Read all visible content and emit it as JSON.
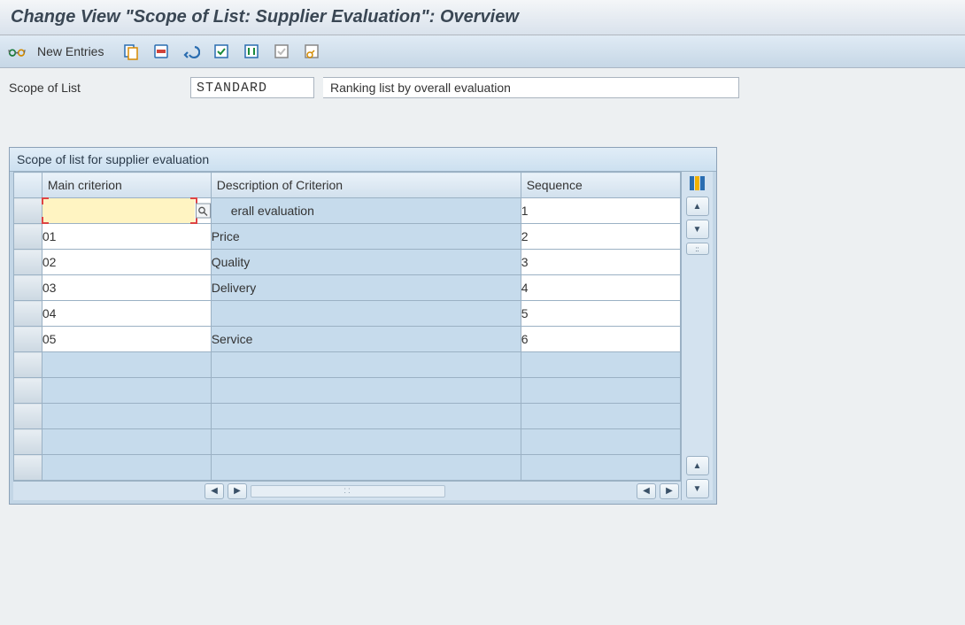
{
  "title": "Change View \"Scope of List: Supplier Evaluation\": Overview",
  "toolbar": {
    "new_entries_label": "New Entries"
  },
  "scope": {
    "label": "Scope of List",
    "value": "STANDARD",
    "description": "Ranking list by overall evaluation"
  },
  "panel": {
    "title": "Scope of list for supplier evaluation",
    "columns": {
      "main": "Main criterion",
      "desc": "Description of Criterion",
      "seq": "Sequence"
    },
    "active_desc_fragment": "erall evaluation",
    "rows": [
      {
        "main": "",
        "desc": "",
        "seq": "1"
      },
      {
        "main": "01",
        "desc": "Price",
        "seq": "2"
      },
      {
        "main": "02",
        "desc": "Quality",
        "seq": "3"
      },
      {
        "main": "03",
        "desc": "Delivery",
        "seq": "4"
      },
      {
        "main": "04",
        "desc": "",
        "seq": "5"
      },
      {
        "main": "05",
        "desc": "Service",
        "seq": "6"
      }
    ]
  }
}
